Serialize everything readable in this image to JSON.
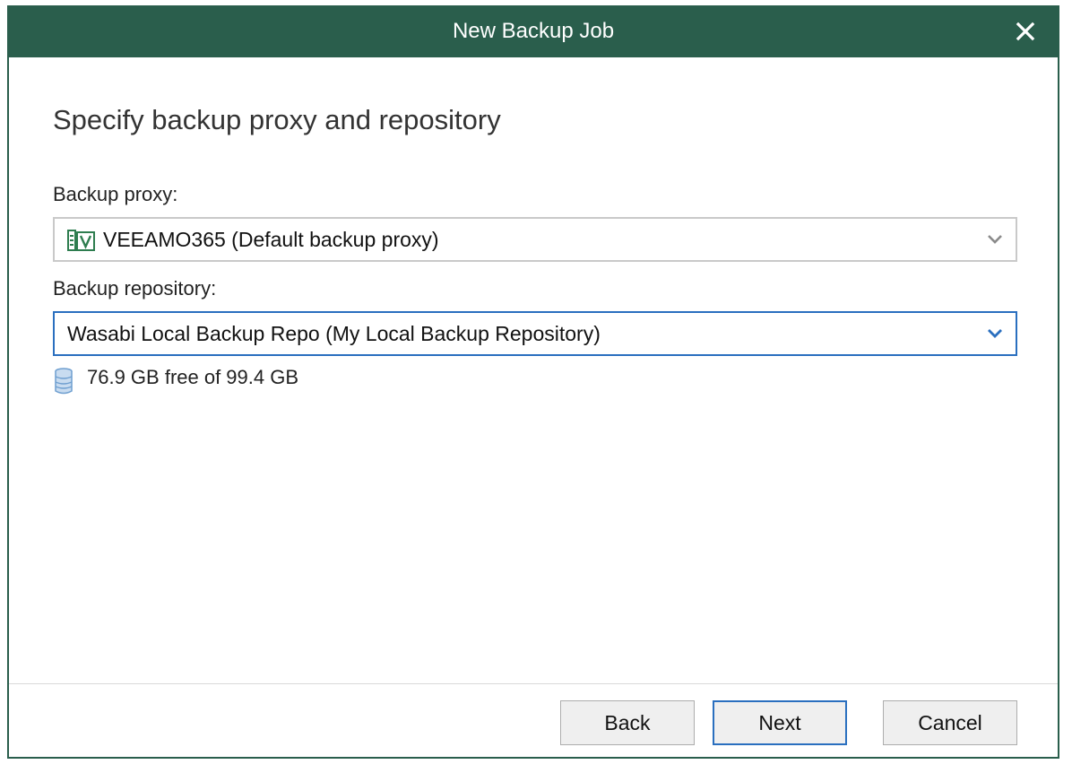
{
  "window": {
    "title": "New Backup Job",
    "close_icon": "close-icon"
  },
  "page": {
    "heading": "Specify backup proxy and repository"
  },
  "proxy": {
    "label": "Backup proxy:",
    "selected": "VEEAMO365 (Default backup proxy)",
    "icon": "veeam-server-icon"
  },
  "repository": {
    "label": "Backup repository:",
    "selected": "Wasabi Local Backup Repo (My Local Backup Repository)",
    "free_space_text": "76.9 GB free of 99.4 GB",
    "icon": "database-icon"
  },
  "buttons": {
    "back": "Back",
    "next": "Next",
    "cancel": "Cancel"
  },
  "colors": {
    "titlebar": "#2a5e4c",
    "focus_border": "#2a6fbf",
    "icon_green": "#2e7d4f",
    "db_blue": "#8fb3d9"
  }
}
